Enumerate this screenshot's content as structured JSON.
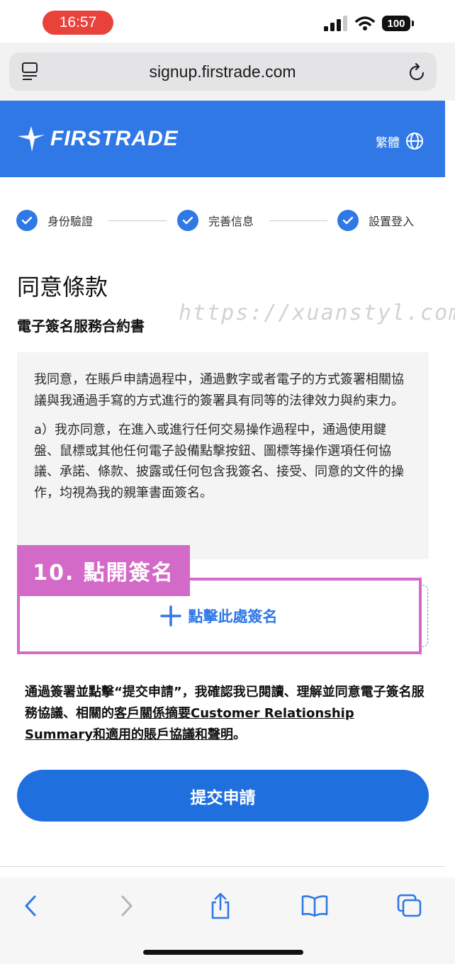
{
  "status_bar": {
    "time": "16:57",
    "battery": "100"
  },
  "browser": {
    "url": "signup.firstrade.com"
  },
  "header": {
    "logo_text": "FIRSTRADE",
    "language": "繁體"
  },
  "steps": [
    {
      "label": "身份驗證"
    },
    {
      "label": "完善信息"
    },
    {
      "label": "設置登入"
    }
  ],
  "page": {
    "title": "同意條款",
    "subtitle": "電子簽名服務合約書",
    "watermark": "https://xuanstyl.com/"
  },
  "terms": {
    "paragraph1": "我同意，在賬戶申請過程中，通過數字或者電子的方式簽署相關協議與我通過手寫的方式進行的簽署具有同等的法律效力與約束力。",
    "paragraph2": "a）我亦同意，在進入或進行任何交易操作過程中，通過使用鍵盤、鼠標或其他任何電子設備點擊按鈕、圖標等操作選項任何協議、承諾、條款、披露或任何包含我簽名、接受、同意的文件的操作，均視為我的親筆書面簽名。"
  },
  "annotation": {
    "label": "10. 點開簽名"
  },
  "signature": {
    "button_label": "點擊此處簽名"
  },
  "agreement": {
    "text_before": "通過簽署並點擊“提交申請”，我確認我已閱讀、理解並同意電子簽名服務協議、相關的",
    "link1": "客戶關係摘要Customer Relationship Summary",
    "link2": "和適用的賬戶協議和聲明",
    "text_after": "。"
  },
  "submit": {
    "label": "提交申請"
  },
  "colors": {
    "brand": "#2f78e6",
    "button": "#1f6fdf",
    "annotation": "#d36ac7",
    "time_pill": "#e8423b"
  }
}
